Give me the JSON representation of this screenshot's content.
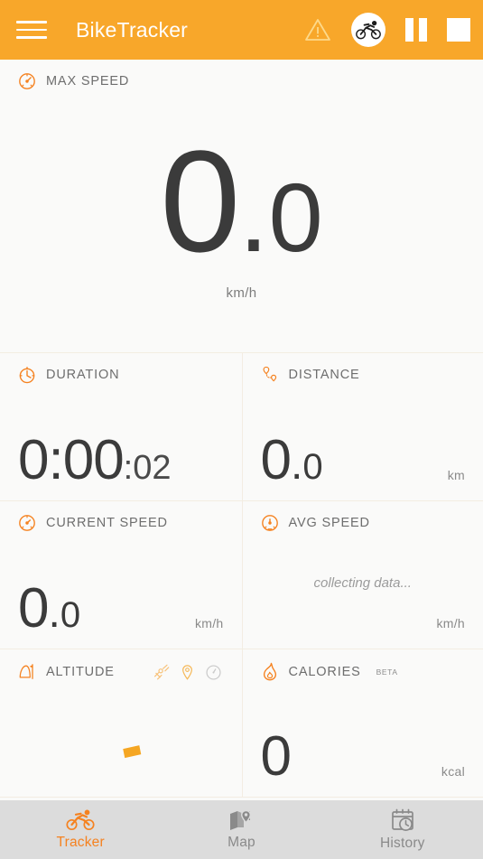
{
  "header": {
    "menu_icon": "hamburger-menu-icon",
    "title": "BikeTracker",
    "actions": [
      {
        "name": "warning-icon",
        "label": "warning"
      },
      {
        "name": "cyclist-icon",
        "label": "cyclist"
      },
      {
        "name": "pause-icon",
        "label": "pause"
      },
      {
        "name": "stop-icon",
        "label": "stop"
      }
    ]
  },
  "hero": {
    "icon": "speedometer-icon",
    "label": "MAX SPEED",
    "integer": "0",
    "separator": ".",
    "decimal": "0",
    "unit": "km/h"
  },
  "metrics": {
    "duration": {
      "icon": "stopwatch-icon",
      "label": "DURATION",
      "main": "0:00",
      "sub": ":02"
    },
    "distance": {
      "icon": "route-pin-icon",
      "label": "DISTANCE",
      "integer": "0",
      "separator": ".",
      "decimal": "0",
      "unit": "km"
    },
    "current_speed": {
      "icon": "speedometer-icon",
      "label": "CURRENT SPEED",
      "integer": "0",
      "separator": ".",
      "decimal": "0",
      "unit": "km/h"
    },
    "avg_speed": {
      "icon": "speedometer-icon",
      "label": "AVG SPEED",
      "placeholder": "collecting data...",
      "unit": "km/h"
    },
    "altitude": {
      "icon": "mountain-icon",
      "label": "ALTITUDE",
      "status_icons": [
        {
          "name": "satellite-signal-icon",
          "state": "active"
        },
        {
          "name": "location-pin-icon",
          "state": "active"
        },
        {
          "name": "compass-icon",
          "state": "inactive"
        }
      ]
    },
    "calories": {
      "icon": "flame-icon",
      "label": "CALORIES",
      "badge": "BETA",
      "value": "0",
      "unit": "kcal"
    }
  },
  "bottom_nav": [
    {
      "name": "nav-tracker",
      "icon": "cyclist-icon",
      "label": "Tracker",
      "active": true
    },
    {
      "name": "nav-map",
      "icon": "map-pin-icon",
      "label": "Map",
      "active": false
    },
    {
      "name": "nav-history",
      "icon": "calendar-clock-icon",
      "label": "History",
      "active": false
    }
  ],
  "colors": {
    "brand_orange": "#F8A72A",
    "accent_orange": "#F58220",
    "header_text": "#FFFFFF",
    "value_text": "#3B3B3B",
    "label_text": "#6E6E6E",
    "divider": "#F3EDE2",
    "nav_bg": "#DCDCDC",
    "page_bg": "#FAFAF9"
  }
}
